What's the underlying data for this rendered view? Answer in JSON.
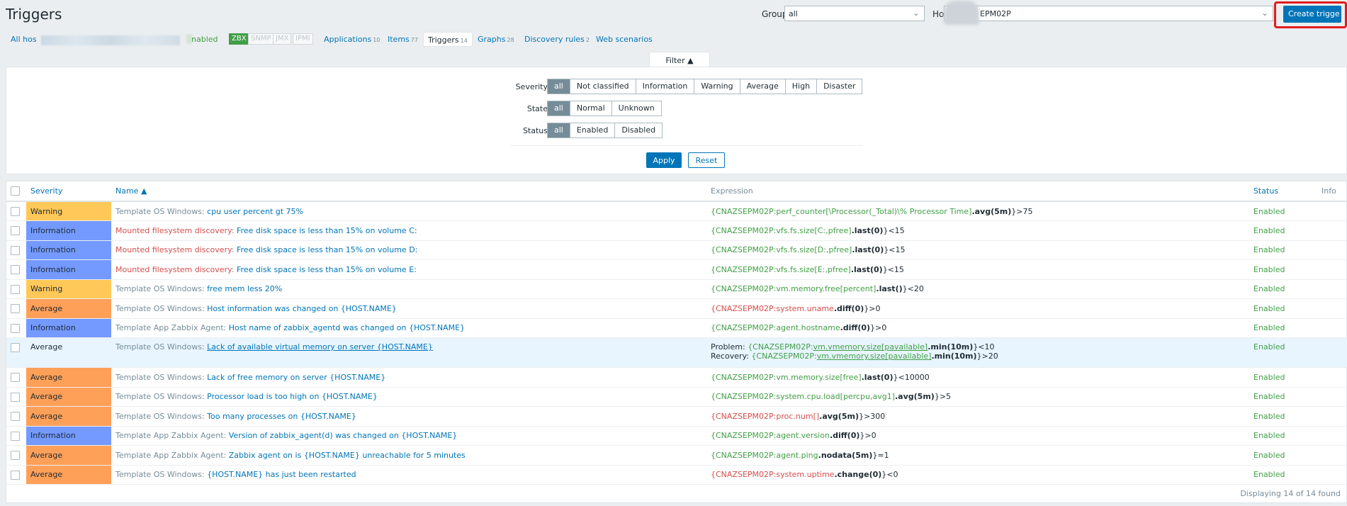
{
  "header": {
    "title": "Triggers",
    "group_label": "Group",
    "group_value": "all",
    "host_label": "Ho",
    "host_value": "EPM02P",
    "create_button": "Create trigge"
  },
  "navbar": {
    "all_hosts": "All hos",
    "enabled": "nabled",
    "tags": [
      "ZBX",
      "SNMP",
      "JMX",
      "IPMI"
    ],
    "tabs": [
      {
        "label": "Applications",
        "count": "10"
      },
      {
        "label": "Items",
        "count": "77"
      },
      {
        "label": "Triggers",
        "count": "14"
      },
      {
        "label": "Graphs",
        "count": "28"
      },
      {
        "label": "Discovery rules",
        "count": "2"
      },
      {
        "label": "Web scenarios",
        "count": ""
      }
    ]
  },
  "filter": {
    "tab_label": "Filter ▲",
    "severity_label": "Severity",
    "severity_options": [
      "all",
      "Not classified",
      "Information",
      "Warning",
      "Average",
      "High",
      "Disaster"
    ],
    "state_label": "State",
    "state_options": [
      "all",
      "Normal",
      "Unknown"
    ],
    "status_label": "Status",
    "status_options": [
      "all",
      "Enabled",
      "Disabled"
    ],
    "apply": "Apply",
    "reset": "Reset"
  },
  "table": {
    "headers": {
      "severity": "Severity",
      "name": "Name ▲",
      "expression": "Expression",
      "status": "Status",
      "info": "Info"
    },
    "rows": [
      {
        "severity": "Warning",
        "tpl": "Template OS Windows",
        "name": "cpu user percent gt 75%",
        "host": "{CNAZSEPM02P:",
        "key": "perf_counter[\\Processor(_Total)\\% Processor Time]",
        "fn": ".avg(5m)",
        "rest": "}>75",
        "status": "Enabled"
      },
      {
        "severity": "Information",
        "tpl": "Mounted filesystem discovery",
        "name": "Free disk space is less than 15% on volume C:",
        "host": "{CNAZSEPM02P:",
        "key": "vfs.fs.size[C:,pfree]",
        "fn": ".last(0)",
        "rest": "}<15",
        "status": "Enabled"
      },
      {
        "severity": "Information",
        "tpl": "Mounted filesystem discovery",
        "name": "Free disk space is less than 15% on volume D:",
        "host": "{CNAZSEPM02P:",
        "key": "vfs.fs.size[D:,pfree]",
        "fn": ".last(0)",
        "rest": "}<15",
        "status": "Enabled"
      },
      {
        "severity": "Information",
        "tpl": "Mounted filesystem discovery",
        "name": "Free disk space is less than 15% on volume E:",
        "host": "{CNAZSEPM02P:",
        "key": "vfs.fs.size[E:,pfree]",
        "fn": ".last(0)",
        "rest": "}<15",
        "status": "Enabled"
      },
      {
        "severity": "Warning",
        "tpl": "Template OS Windows",
        "name": "free mem less 20%",
        "host": "{CNAZSEPM02P:",
        "key": "vm.memory.free[percent]",
        "fn": ".last()",
        "rest": "}<20",
        "status": "Enabled"
      },
      {
        "severity": "Average",
        "tpl": "Template OS Windows",
        "name": "Host information was changed on {HOST.NAME}",
        "host": "{CNAZSEPM02P:",
        "key": "system.uname",
        "fn": ".diff(0)",
        "rest": "}>0",
        "status": "Enabled"
      },
      {
        "severity": "Information",
        "tpl": "Template App Zabbix Agent",
        "name": "Host name of zabbix_agentd was changed on {HOST.NAME}",
        "host": "{CNAZSEPM02P:",
        "key": "agent.hostname",
        "fn": ".diff(0)",
        "rest": "}>0",
        "status": "Enabled"
      },
      {
        "severity": "Average",
        "tpl": "Template OS Windows",
        "name": "Lack of available virtual memory on server {HOST.NAME}",
        "problem_label": "Problem: ",
        "recovery_label": "Recovery: ",
        "p_host": "{CNAZSEPM02P:",
        "p_key": "vm.vmemory.size[pavailable]",
        "p_fn": ".min(10m)",
        "p_rest": "}<10",
        "r_host": "{CNAZSEPM02P:",
        "r_key": "vm.vmemory.size[pavailable]",
        "r_fn": ".min(10m)",
        "r_rest": "}>20",
        "status": "Enabled"
      },
      {
        "severity": "Average",
        "tpl": "Template OS Windows",
        "name": "Lack of free memory on server {HOST.NAME}",
        "host": "{CNAZSEPM02P:",
        "key": "vm.memory.size[free]",
        "fn": ".last(0)",
        "rest": "}<10000",
        "status": "Enabled"
      },
      {
        "severity": "Average",
        "tpl": "Template OS Windows",
        "name": "Processor load is too high on {HOST.NAME}",
        "host": "{CNAZSEPM02P:",
        "key": "system.cpu.load[percpu,avg1]",
        "fn": ".avg(5m)",
        "rest": "}>5",
        "status": "Enabled"
      },
      {
        "severity": "Average",
        "tpl": "Template OS Windows",
        "name": "Too many processes on {HOST.NAME}",
        "host": "{CNAZSEPM02P:",
        "key": "proc.num[]",
        "fn": ".avg(5m)",
        "rest": "}>300",
        "status": "Enabled"
      },
      {
        "severity": "Information",
        "tpl": "Template App Zabbix Agent",
        "name": "Version of zabbix_agent(d) was changed on {HOST.NAME}",
        "host": "{CNAZSEPM02P:",
        "key": "agent.version",
        "fn": ".diff(0)",
        "rest": "}>0",
        "status": "Enabled"
      },
      {
        "severity": "Average",
        "tpl": "Template App Zabbix Agent",
        "name": "Zabbix agent on is {HOST.NAME} unreachable for 5 minutes",
        "host": "{CNAZSEPM02P:",
        "key": "agent.ping",
        "fn": ".nodata(5m)",
        "rest": "}=1",
        "status": "Enabled"
      },
      {
        "severity": "Average",
        "tpl": "Template OS Windows",
        "name": "{HOST.NAME} has just been restarted",
        "host": "{CNAZSEPM02P:",
        "key": "system.uptime",
        "fn": ".change(0)",
        "rest": "}<0",
        "status": "Enabled"
      }
    ],
    "footer": "Displaying 14 of 14 found"
  }
}
